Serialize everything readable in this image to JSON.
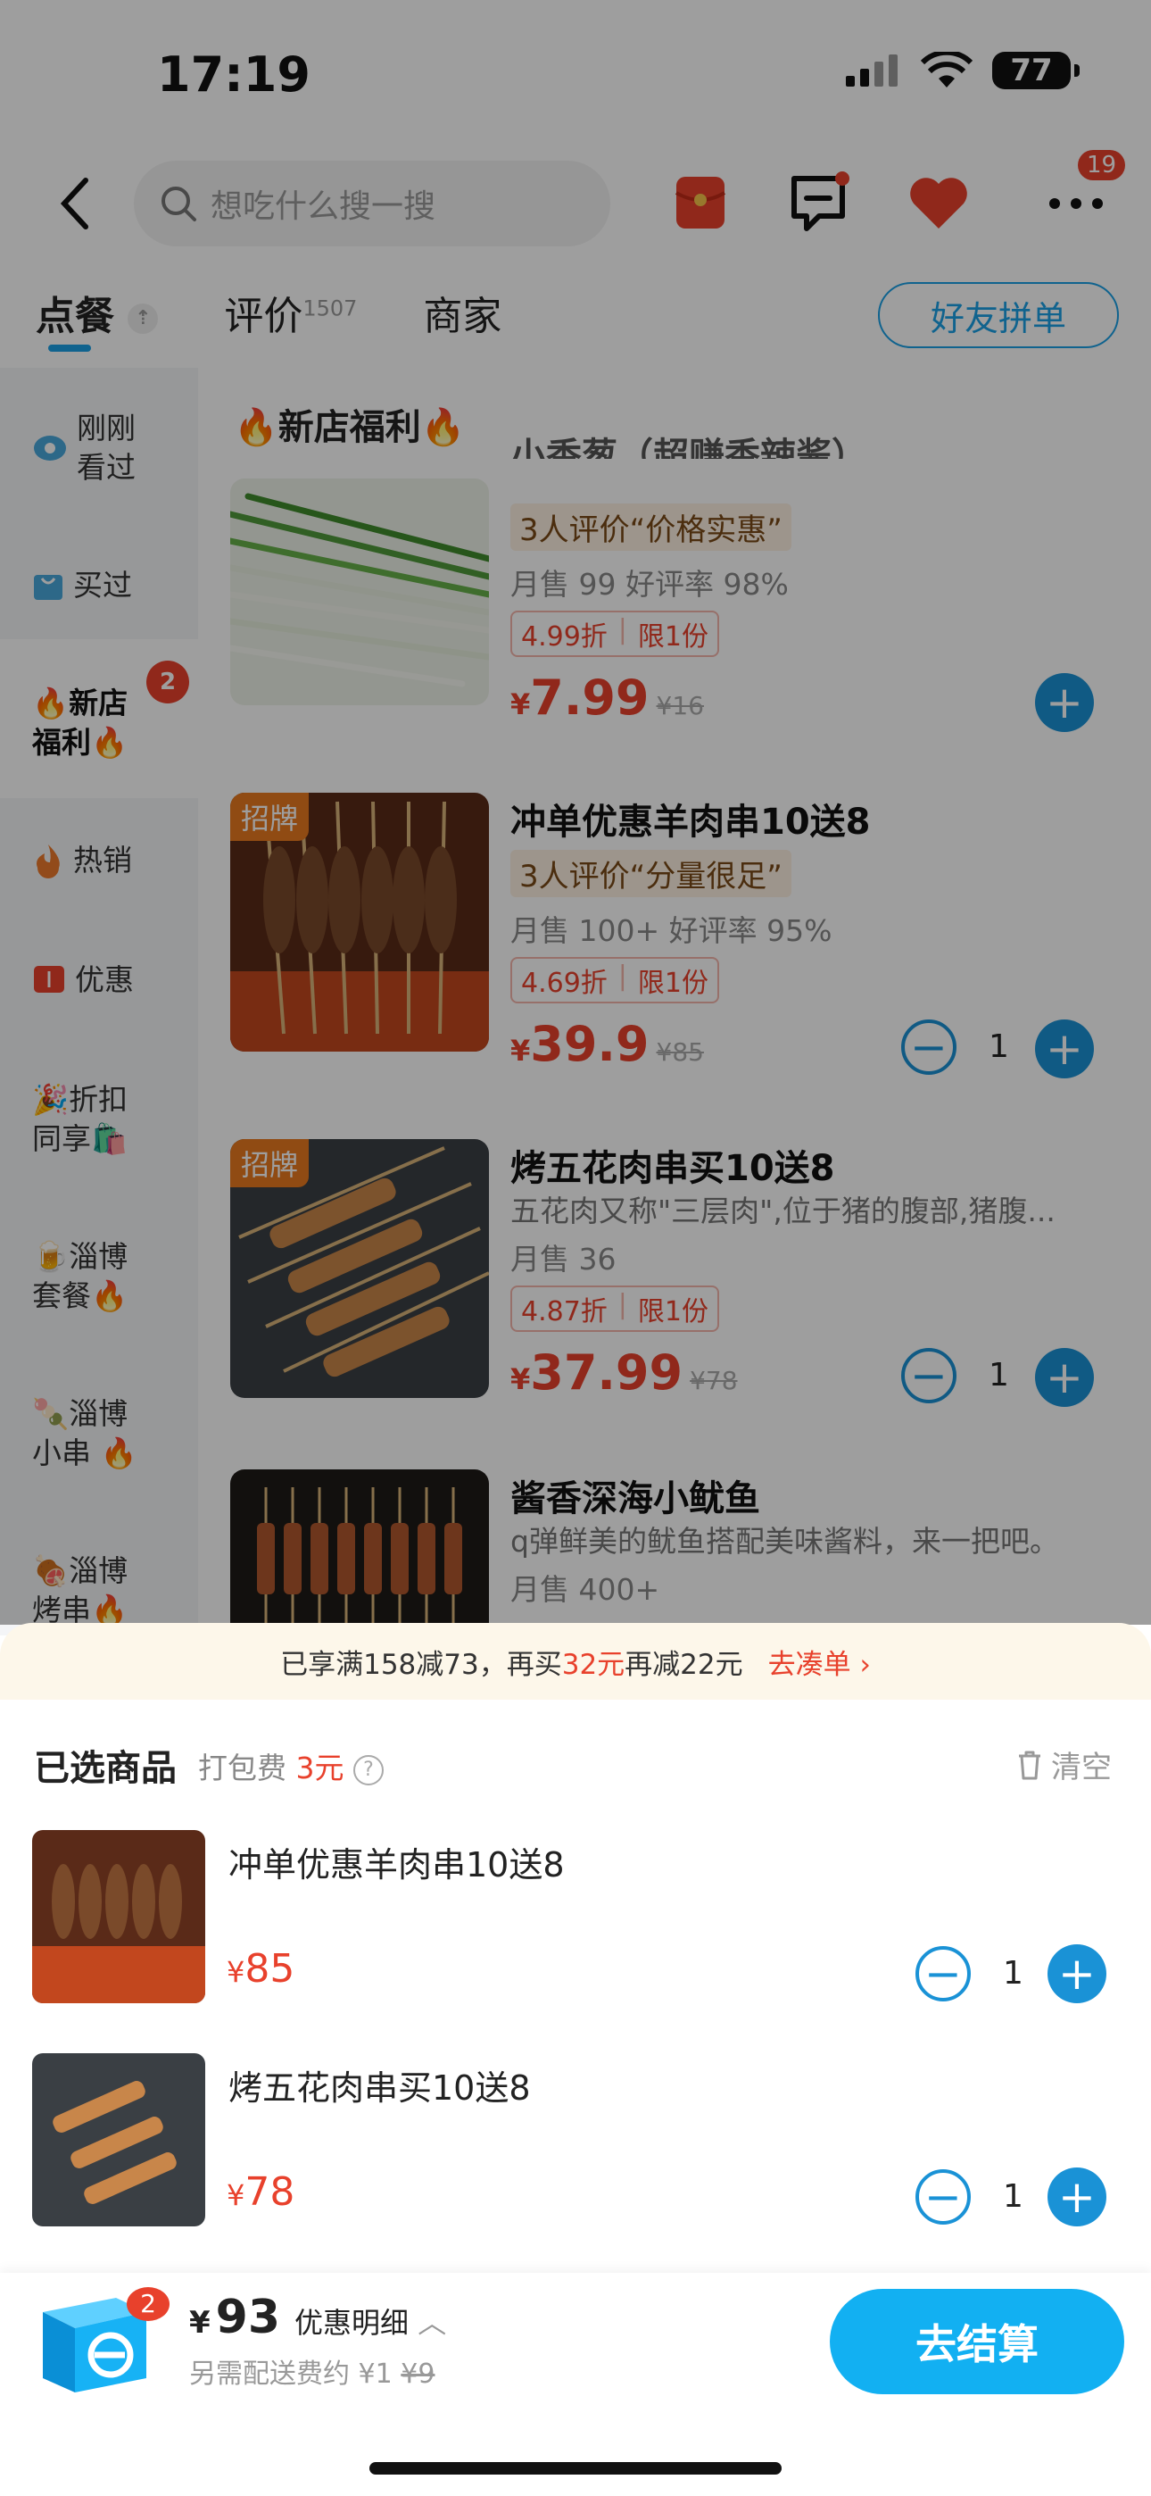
{
  "status_bar": {
    "time": "17:19",
    "battery": "77"
  },
  "header": {
    "search_placeholder": "想吃什么搜一搜",
    "more_badge": "19"
  },
  "tabs": [
    {
      "label": "点餐"
    },
    {
      "label": "评价",
      "count": "1507"
    },
    {
      "label": "商家"
    }
  ],
  "friend_group_label": "好友拼单",
  "sidebar": {
    "items": [
      {
        "label": "刚刚看过",
        "icon": "eye-icon"
      },
      {
        "label": "买过",
        "icon": "bag-icon"
      },
      {
        "label": "🔥新店福利🔥",
        "badge": "2",
        "icon": ""
      },
      {
        "label": "热销",
        "icon": "flame-icon"
      },
      {
        "label": "优惠",
        "icon": "coupon-icon"
      },
      {
        "label": "🎉折扣同享🛍️",
        "icon": ""
      },
      {
        "label": "🍺淄博套餐🔥",
        "icon": ""
      },
      {
        "label": "🍡淄博小串 🔥",
        "icon": ""
      },
      {
        "label": "🍖淄博烤串🔥",
        "icon": ""
      }
    ]
  },
  "section_title": "🔥新店福利🔥",
  "products": [
    {
      "name": "小香葱（超赚香辣酱）",
      "tag": "3人评价“价格实惠”",
      "meta": "月售 99 好评率 98%",
      "discount": "4.99折",
      "limit": "限1份",
      "currency": "¥",
      "price": "7.99",
      "old_price": "¥16",
      "badge": "",
      "qty": ""
    },
    {
      "name": "冲单优惠羊肉串10送8",
      "tag": "3人评价“分量很足”",
      "meta": "月售 100+ 好评率 95%",
      "discount": "4.69折",
      "limit": "限1份",
      "currency": "¥",
      "price": "39.9",
      "old_price": "¥85",
      "badge": "招牌",
      "qty": "1"
    },
    {
      "name": "烤五花肉串买10送8",
      "desc": "五花肉又称\"三层肉\",位于猪的腹部,猪腹...",
      "meta": "月售 36",
      "discount": "4.87折",
      "limit": "限1份",
      "currency": "¥",
      "price": "37.99",
      "old_price": "¥78",
      "badge": "招牌",
      "qty": "1"
    },
    {
      "name": "酱香深海小鱿鱼",
      "desc": "q弹鲜美的鱿鱼搭配美味酱料，来一把吧。",
      "meta": "月售 400+"
    }
  ],
  "promo": {
    "text_a": "已享满158减73，再买",
    "amount": "32元",
    "text_b": "再减22元",
    "link": "去凑单"
  },
  "cart": {
    "title": "已选商品",
    "pack_fee_label": "打包费",
    "pack_fee_value": "3元",
    "clear_label": "清空",
    "items": [
      {
        "name": "冲单优惠羊肉串10送8",
        "currency": "¥",
        "price": "85",
        "qty": "1"
      },
      {
        "name": "烤五花肉串买10送8",
        "currency": "¥",
        "price": "78",
        "qty": "1"
      }
    ]
  },
  "bottom_bar": {
    "cart_badge": "2",
    "total_currency": "¥",
    "total": "93",
    "discount_detail": "优惠明细",
    "delivery_note": "另需配送费约 ¥1",
    "delivery_old": "¥9",
    "checkout_label": "去结算"
  },
  "colors": {
    "accent_blue": "#1a92d6",
    "price_red": "#e8412c",
    "checkout_blue": "#12b0f2"
  }
}
